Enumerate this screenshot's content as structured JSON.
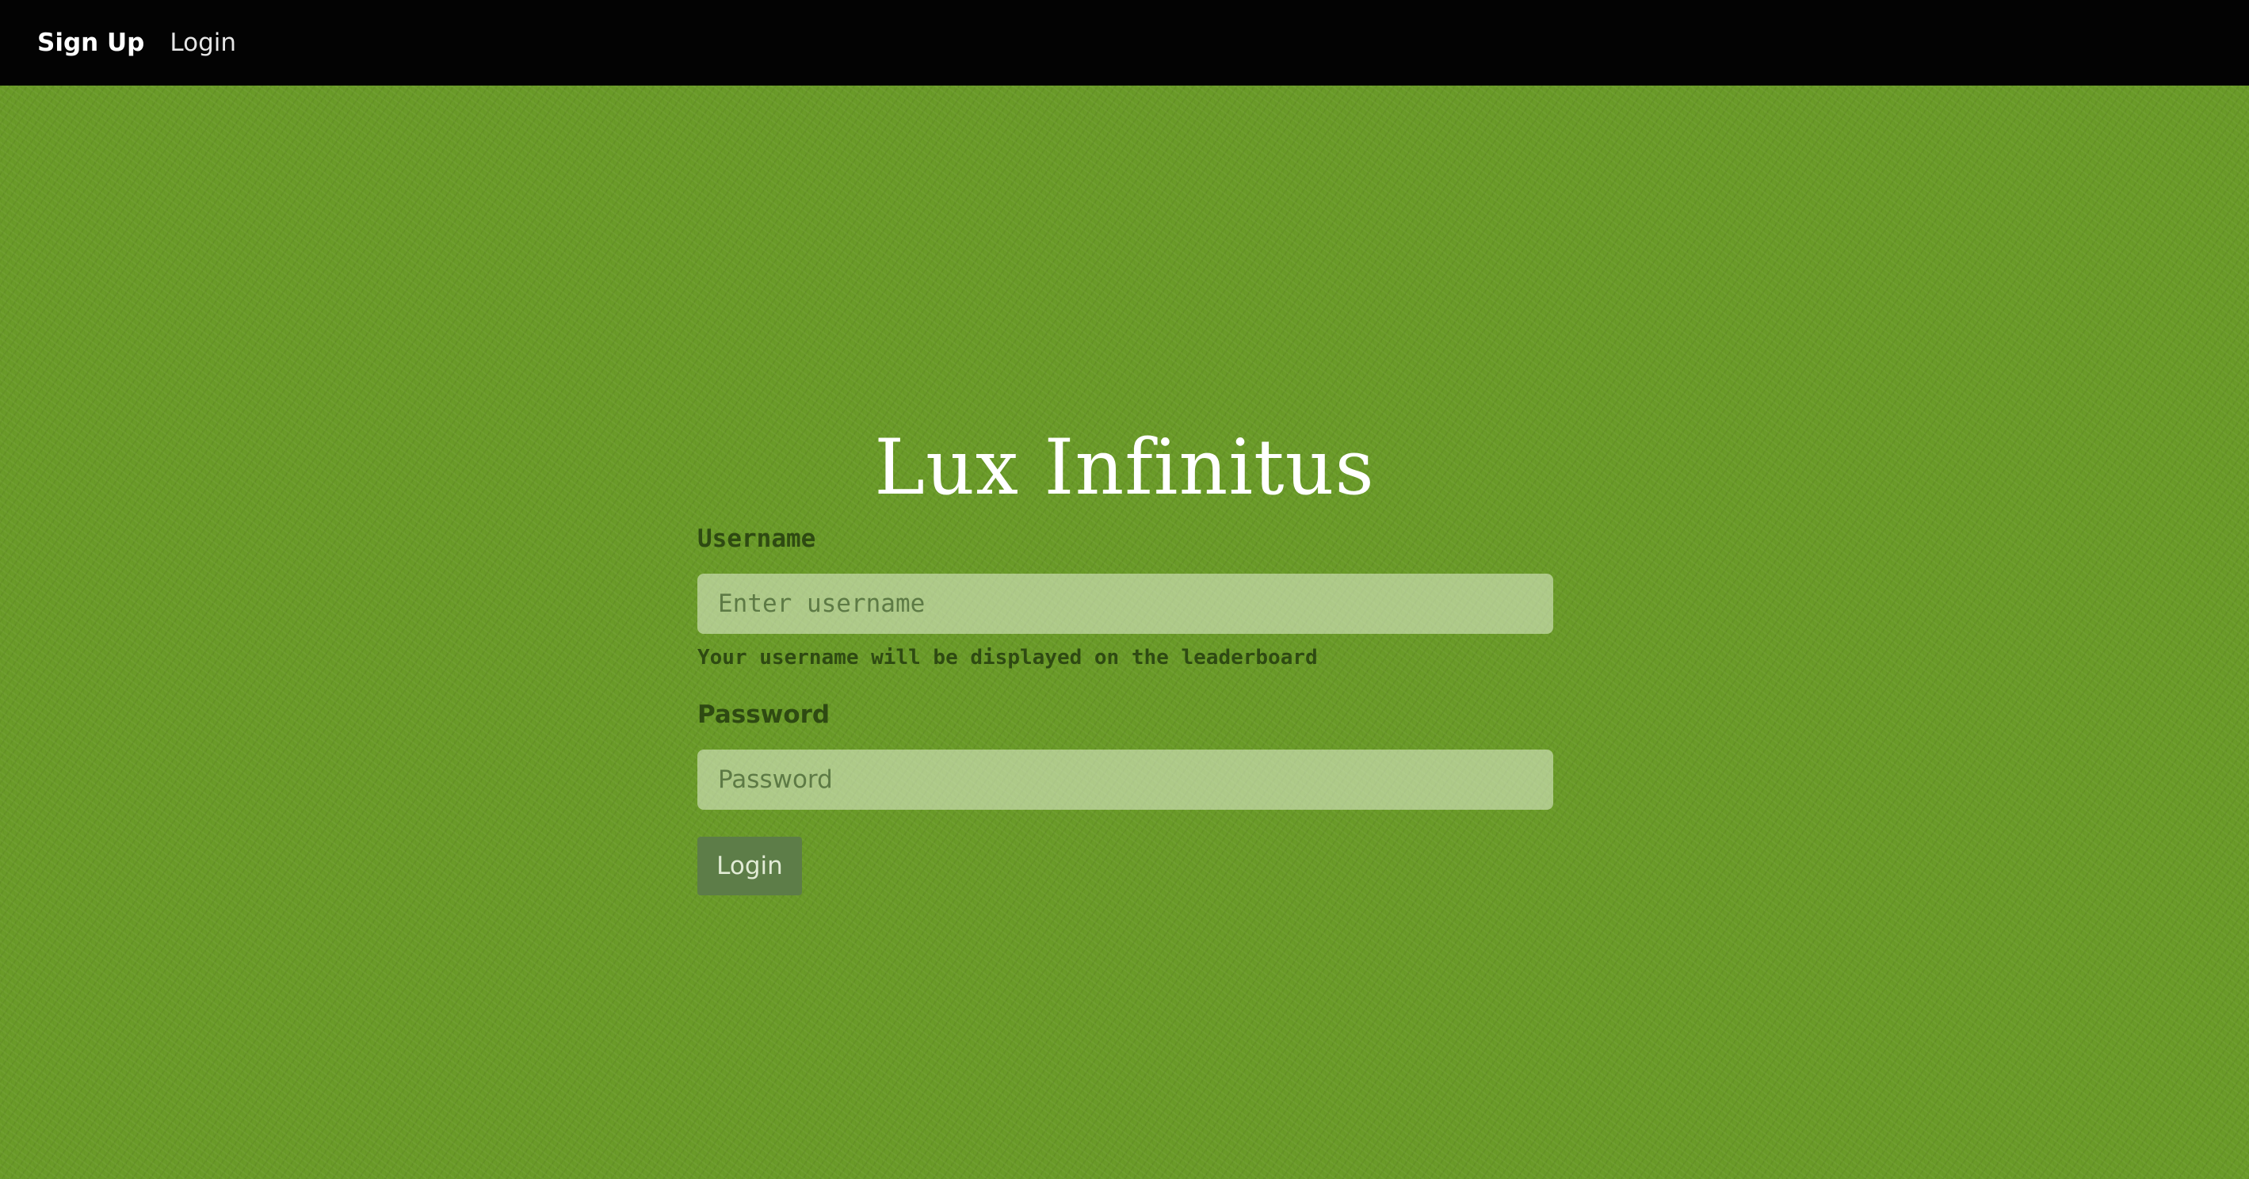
{
  "nav": {
    "signup_label": "Sign Up",
    "login_label": "Login"
  },
  "page": {
    "title": "Lux Infinitus"
  },
  "form": {
    "username_label": "Username",
    "username_placeholder": "Enter username",
    "username_value": "",
    "username_help": "Your username will be displayed on the leaderboard",
    "password_label": "Password",
    "password_placeholder": "Password",
    "password_value": "",
    "submit_label": "Login"
  },
  "colors": {
    "background": "#6a9b28",
    "navbar": "#030303",
    "button": "#5d7d48",
    "label_text": "#2e4a12"
  }
}
